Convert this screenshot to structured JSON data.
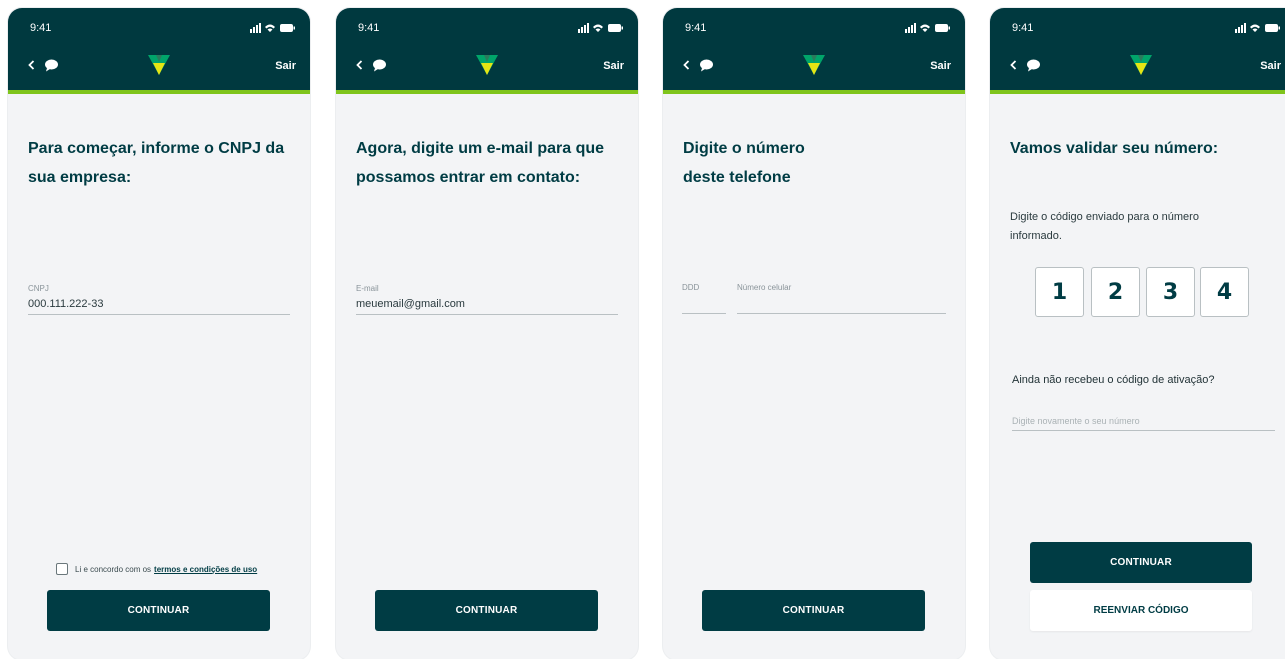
{
  "status_bar": {
    "time": "9:41"
  },
  "header": {
    "exit_label": "Sair",
    "icons": [
      "back-chevron-icon",
      "chat-bubble-icon",
      "logo-icon",
      "signal-icon",
      "wifi-icon",
      "battery-icon"
    ]
  },
  "colors": {
    "header_bg": "#00393f",
    "accent_green": "#7fc41c",
    "button_bg": "#003c44",
    "page_bg": "#f3f4f6"
  },
  "screens": [
    {
      "title": "Para começar, informe o CNPJ da sua empresa:",
      "field_label": "CNPJ",
      "field_value": "000.111.222-33",
      "terms_prefix": "Li e concordo com os",
      "terms_link": "termos e condições de uso",
      "continue_label": "CONTINUAR"
    },
    {
      "title": "Agora, digite um e-mail para que possamos entrar em contato:",
      "field_label": "E-mail",
      "field_value": "meuemail@gmail.com",
      "continue_label": "CONTINUAR"
    },
    {
      "title_line1": "Digite o número",
      "title_line2": "deste telefone",
      "ddd_label": "DDD",
      "phone_label": "Número celular",
      "continue_label": "CONTINUAR"
    },
    {
      "title": "Vamos validar seu número:",
      "subtitle": "Digite o código enviado para o número informado.",
      "code_digits": [
        "1",
        "2",
        "3",
        "4"
      ],
      "question": "Ainda não recebeu o código de ativação?",
      "resend_placeholder": "Digite novamente o seu número",
      "continue_label": "CONTINUAR",
      "resend_label": "REENVIAR CÓDIGO"
    }
  ]
}
